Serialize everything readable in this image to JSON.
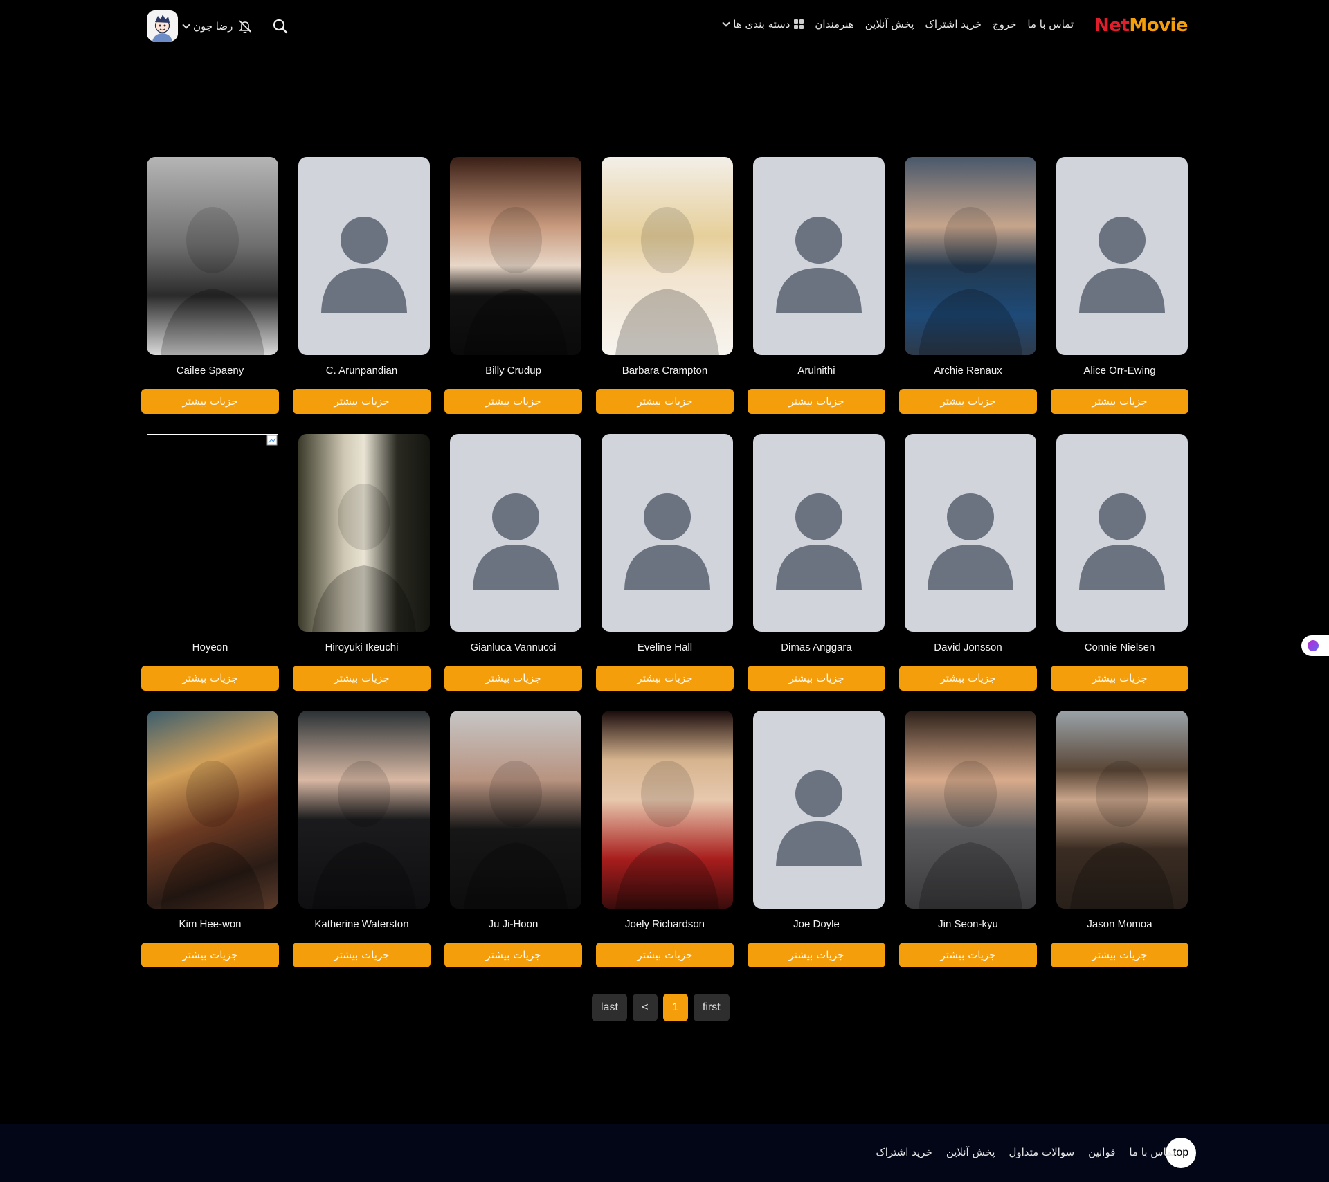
{
  "header": {
    "logo_part1": "Net",
    "logo_part2": "Movie",
    "nav": {
      "categories": "دسته بندی ها",
      "artists": "هنرمندان",
      "stream": "پخش آنلاین",
      "subscribe": "خرید اشتراک",
      "logout": "خروج",
      "contact": "تماس با ما"
    },
    "user_name": "رضا جون"
  },
  "details_label": "جزیات بیشتر",
  "actors": [
    {
      "name": "Cailee Spaeny",
      "photo": "bw-portrait"
    },
    {
      "name": "C. Arunpandian",
      "photo": "placeholder"
    },
    {
      "name": "Billy Crudup",
      "photo": "suit-portrait"
    },
    {
      "name": "Barbara Crampton",
      "photo": "blonde-portrait"
    },
    {
      "name": "Arulnithi",
      "photo": "placeholder"
    },
    {
      "name": "Archie Renaux",
      "photo": "blue-suit-portrait"
    },
    {
      "name": "Alice Orr-Ewing",
      "photo": "placeholder"
    },
    {
      "name": "Hoyeon",
      "photo": "broken"
    },
    {
      "name": "Hiroyuki Ikeuchi",
      "photo": "film-still"
    },
    {
      "name": "Gianluca Vannucci",
      "photo": "placeholder"
    },
    {
      "name": "Eveline Hall",
      "photo": "placeholder"
    },
    {
      "name": "Dimas Anggara",
      "photo": "placeholder"
    },
    {
      "name": "David Jonsson",
      "photo": "placeholder"
    },
    {
      "name": "Connie Nielsen",
      "photo": "placeholder"
    },
    {
      "name": "Kim Hee-won",
      "photo": "restaurant-still"
    },
    {
      "name": "Katherine Waterston",
      "photo": "dark-portrait"
    },
    {
      "name": "Ju Ji-Hoon",
      "photo": "grey-suit-portrait"
    },
    {
      "name": "Joely Richardson",
      "photo": "red-dress-portrait"
    },
    {
      "name": "Joe Doyle",
      "photo": "placeholder"
    },
    {
      "name": "Jin Seon-kyu",
      "photo": "smiling-portrait"
    },
    {
      "name": "Jason Momoa",
      "photo": "long-hair-portrait"
    }
  ],
  "pagination": {
    "last": "last",
    "prev": "<",
    "current": "1",
    "first": "first"
  },
  "footer": {
    "top": "top",
    "links": [
      "خرید اشتراک",
      "پخش آنلاین",
      "سوالات متداول",
      "قوانین",
      "تماس با ما"
    ]
  },
  "colors": {
    "accent": "#f59e0b",
    "logo_red": "#e11d2b",
    "footer_bg": "#020617",
    "placeholder_bg": "#d1d5db",
    "placeholder_fg": "#6b7280"
  }
}
